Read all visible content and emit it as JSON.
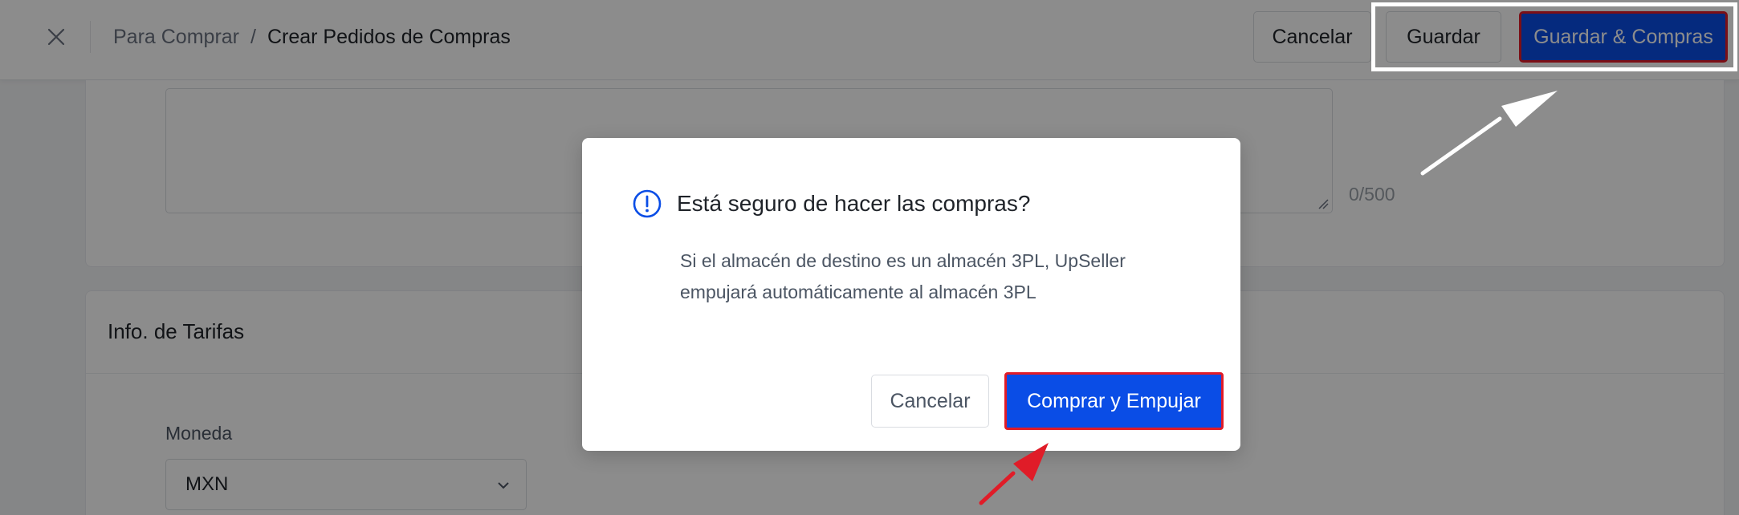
{
  "header": {
    "breadcrumb": {
      "parent": "Para Comprar",
      "separator": "/",
      "current": "Crear Pedidos de Compras"
    },
    "buttons": {
      "cancel": "Cancelar",
      "save": "Guardar",
      "save_and_buy": "Guardar & Compras"
    },
    "icons": {
      "close": "close-icon"
    }
  },
  "notes": {
    "char_count": "0/500"
  },
  "tarifas": {
    "title": "Info. de Tarifas",
    "currency_label": "Moneda",
    "currency_value": "MXN"
  },
  "modal": {
    "title": "Está seguro de hacer las compras?",
    "body_line1": "Si el almacén de destino es un almacén 3PL, UpSeller",
    "body_line2": "empujará automáticamente al almacén 3PL",
    "cancel": "Cancelar",
    "confirm": "Comprar y Empujar",
    "icon": "info-circle-icon"
  },
  "colors": {
    "primary": "#0a4de6",
    "highlight_red": "#e01c28",
    "annotation_white": "#ffffff",
    "mask": "rgba(0,0,0,0.45)"
  }
}
